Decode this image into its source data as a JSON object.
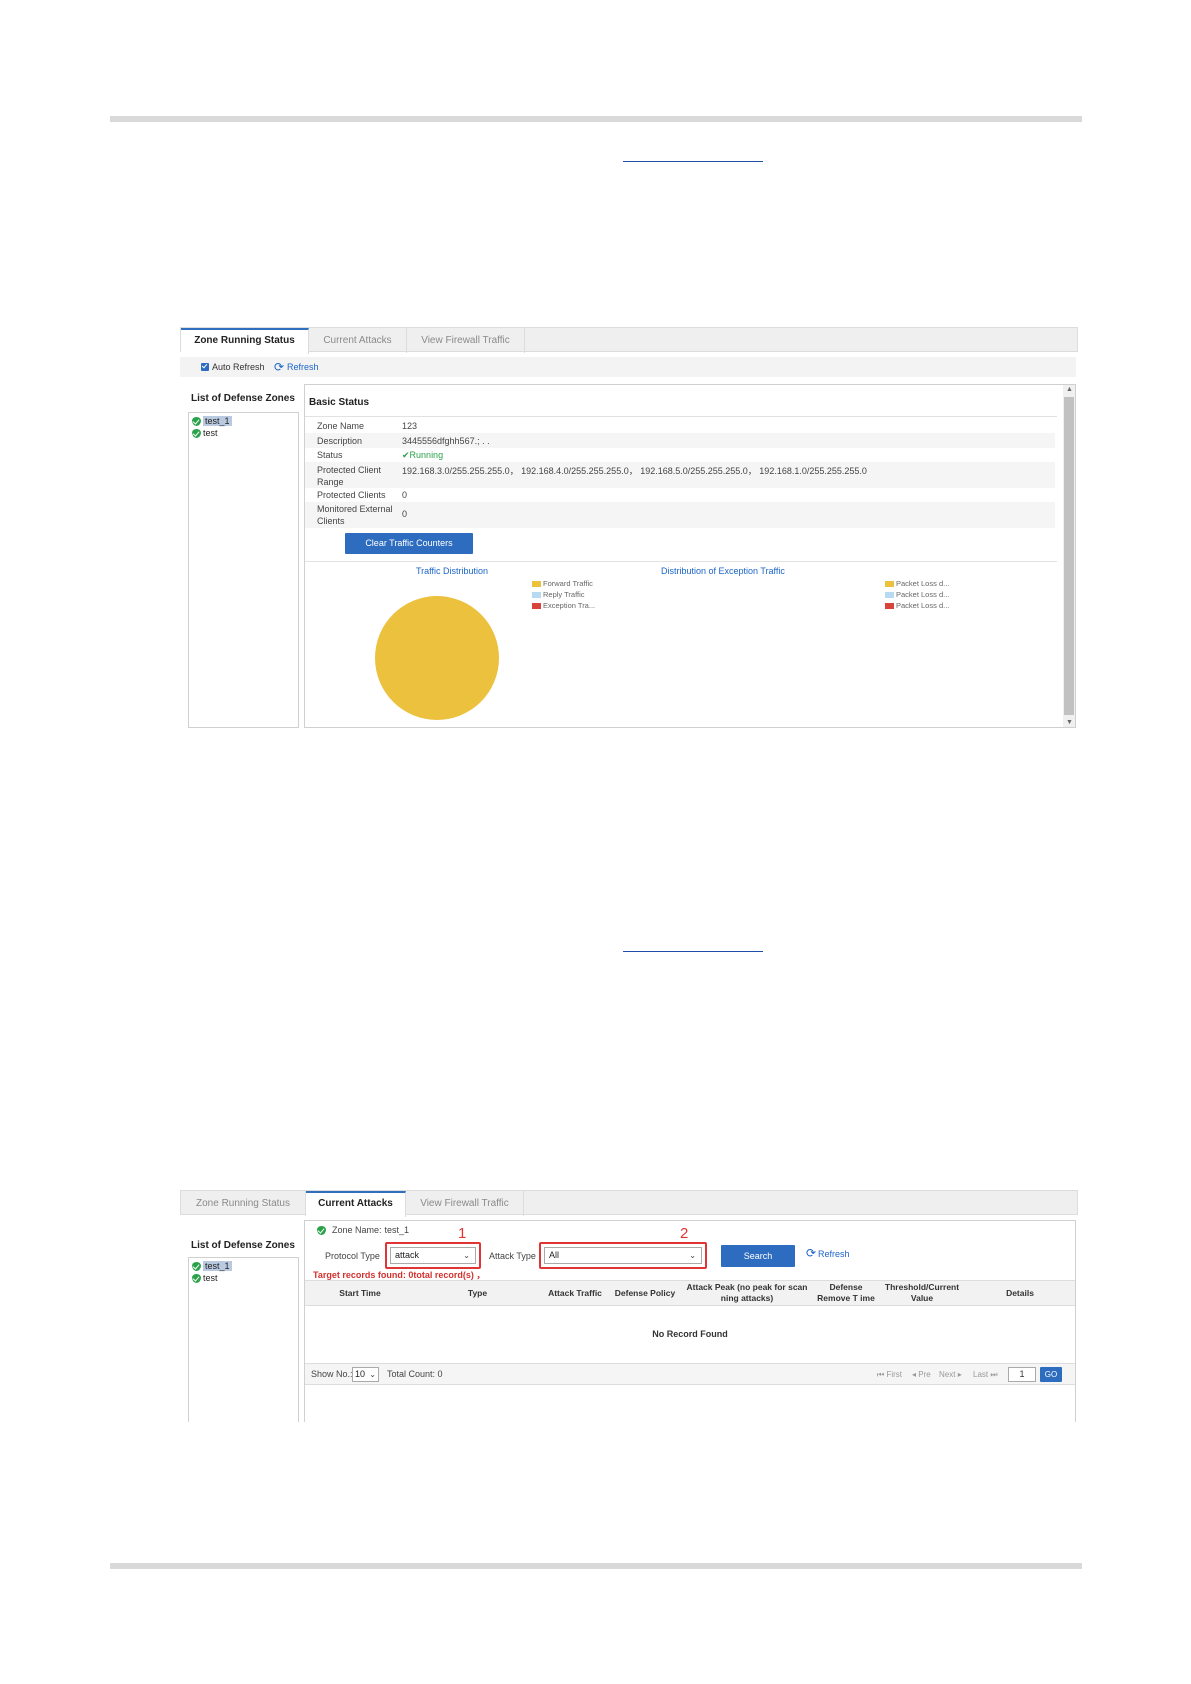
{
  "screen1": {
    "tabs": [
      "Zone Running Status",
      "Current Attacks",
      "View Firewall Traffic"
    ],
    "auto_refresh_label": "Auto Refresh",
    "refresh_label": "Refresh",
    "zones_title": "List of Defense Zones",
    "zones": [
      "test_1",
      "test"
    ],
    "basic_status_title": "Basic Status",
    "rows": [
      {
        "key": "Zone Name",
        "value": "123"
      },
      {
        "key": "Description",
        "value": "3445556dfghh567.; . ."
      },
      {
        "key": "Status",
        "value": "Running"
      },
      {
        "key": "Protected Client Range",
        "value": "192.168.3.0/255.255.255.0， 192.168.4.0/255.255.255.0， 192.168.5.0/255.255.255.0， 192.168.1.0/255.255.255.0"
      },
      {
        "key": "Protected Clients",
        "value": "0"
      },
      {
        "key": "Monitored External Clients",
        "value": "0"
      }
    ],
    "clear_button": "Clear Traffic Counters",
    "chart1_title": "Traffic Distribution",
    "chart2_title": "Distribution of Exception Traffic",
    "legend1": [
      "Forward Traffic",
      "Reply Traffic",
      "Exception Tra..."
    ],
    "legend2": [
      "Packet Loss d...",
      "Packet Loss d...",
      "Packet Loss d..."
    ],
    "colors": {
      "forward": "#ecc13e",
      "reply": "#b8d9f2",
      "exception": "#d9443a",
      "accent": "#2d6cbf"
    }
  },
  "screen2": {
    "tabs": [
      "Zone Running Status",
      "Current Attacks",
      "View Firewall Traffic"
    ],
    "zones_title": "List of Defense Zones",
    "zones": [
      "test_1",
      "test"
    ],
    "zone_name_label": "Zone Name:",
    "zone_name_value": "test_1",
    "protocol_type_label": "Protocol Type",
    "protocol_type_value": "attack",
    "attack_type_label": "Attack Type",
    "attack_type_value": "All",
    "marker1": "1",
    "marker2": "2",
    "search_button": "Search",
    "refresh_label": "Refresh",
    "target_records": "Target records found: 0total record(s) ，",
    "columns": [
      "Start Time",
      "Type",
      "Attack Traffic",
      "Defense Policy",
      "Attack Peak (no peak for scan ning attacks)",
      "Defense Remove T ime",
      "Threshold/Current Value",
      "Details"
    ],
    "no_record": "No Record Found",
    "show_no_label": "Show No.:",
    "show_no_value": "10",
    "total_count": "Total Count: 0",
    "pager": {
      "first": "First",
      "prev": "Pre",
      "next": "Next",
      "last": "Last"
    },
    "page_value": "1",
    "go_button": "GO"
  }
}
